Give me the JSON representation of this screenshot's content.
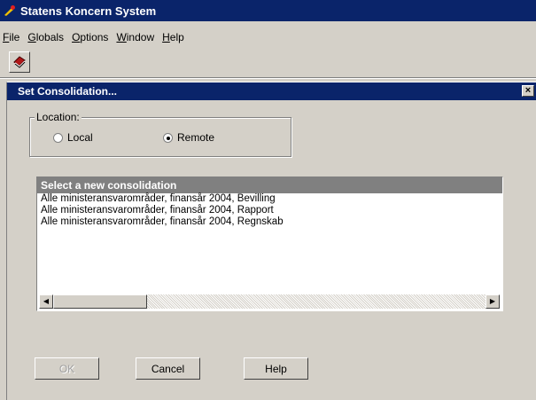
{
  "app": {
    "title": "Statens Koncern System"
  },
  "menu": [
    {
      "label": "File"
    },
    {
      "label": "Globals"
    },
    {
      "label": "Options"
    },
    {
      "label": "Window"
    },
    {
      "label": "Help"
    }
  ],
  "toolbar": {
    "button_icon": "book-icon"
  },
  "dialog": {
    "title": "Set Consolidation...",
    "location": {
      "legend": "Location:",
      "options": [
        {
          "label": "Local",
          "selected": false
        },
        {
          "label": "Remote",
          "selected": true
        }
      ]
    },
    "list": {
      "header": "Select a new consolidation",
      "items": [
        "Alle ministeransvarområder, finansår 2004, Bevilling",
        "Alle ministeransvarområder, finansår 2004, Rapport",
        "Alle ministeransvarområder, finansår 2004, Regnskab"
      ]
    },
    "buttons": {
      "ok": "OK",
      "cancel": "Cancel",
      "help": "Help"
    }
  }
}
